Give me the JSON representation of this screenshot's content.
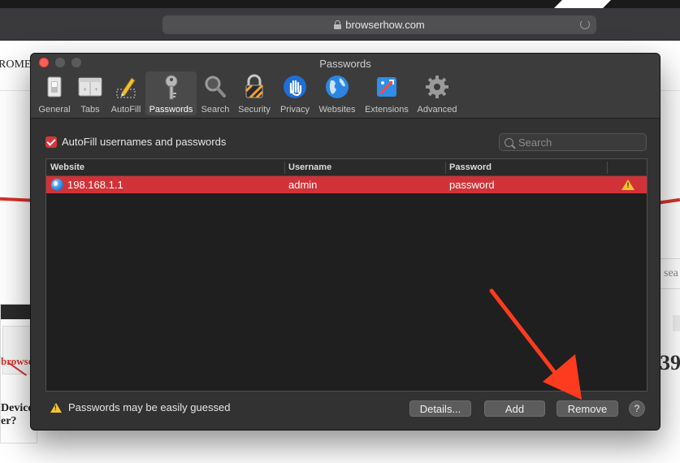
{
  "browser": {
    "address": "browserhow.com",
    "background": {
      "brand_fragment": "ROME",
      "search_fragment": "sea",
      "number_fragment": "39",
      "card_brand": "browse",
      "card_title_line1": "Devices",
      "card_title_line2": "er?"
    }
  },
  "dialog": {
    "title": "Passwords",
    "toolbar": [
      {
        "label": "General",
        "icon": "general-switch-icon"
      },
      {
        "label": "Tabs",
        "icon": "tabs-icon"
      },
      {
        "label": "AutoFill",
        "icon": "autofill-pencil-icon"
      },
      {
        "label": "Passwords",
        "icon": "key-icon",
        "active": true
      },
      {
        "label": "Search",
        "icon": "magnifier-icon"
      },
      {
        "label": "Security",
        "icon": "padlock-icon"
      },
      {
        "label": "Privacy",
        "icon": "hand-icon"
      },
      {
        "label": "Websites",
        "icon": "globe-icon"
      },
      {
        "label": "Extensions",
        "icon": "puzzle-extension-icon"
      },
      {
        "label": "Advanced",
        "icon": "gear-icon"
      }
    ],
    "autofill_label": "AutoFill usernames and passwords",
    "autofill_checked": true,
    "search_placeholder": "Search",
    "table": {
      "columns": [
        "Website",
        "Username",
        "Password"
      ],
      "rows": [
        {
          "website": "198.168.1.1",
          "username": "admin",
          "password": "password",
          "warning": true,
          "selected": true
        }
      ]
    },
    "footer": {
      "warning_text": "Passwords may be easily guessed",
      "details_label": "Details...",
      "add_label": "Add",
      "remove_label": "Remove",
      "help_label": "?"
    }
  },
  "colors": {
    "selection": "#d13238",
    "annotation_arrow": "#ff3b1f",
    "warning": "#f4c430"
  }
}
